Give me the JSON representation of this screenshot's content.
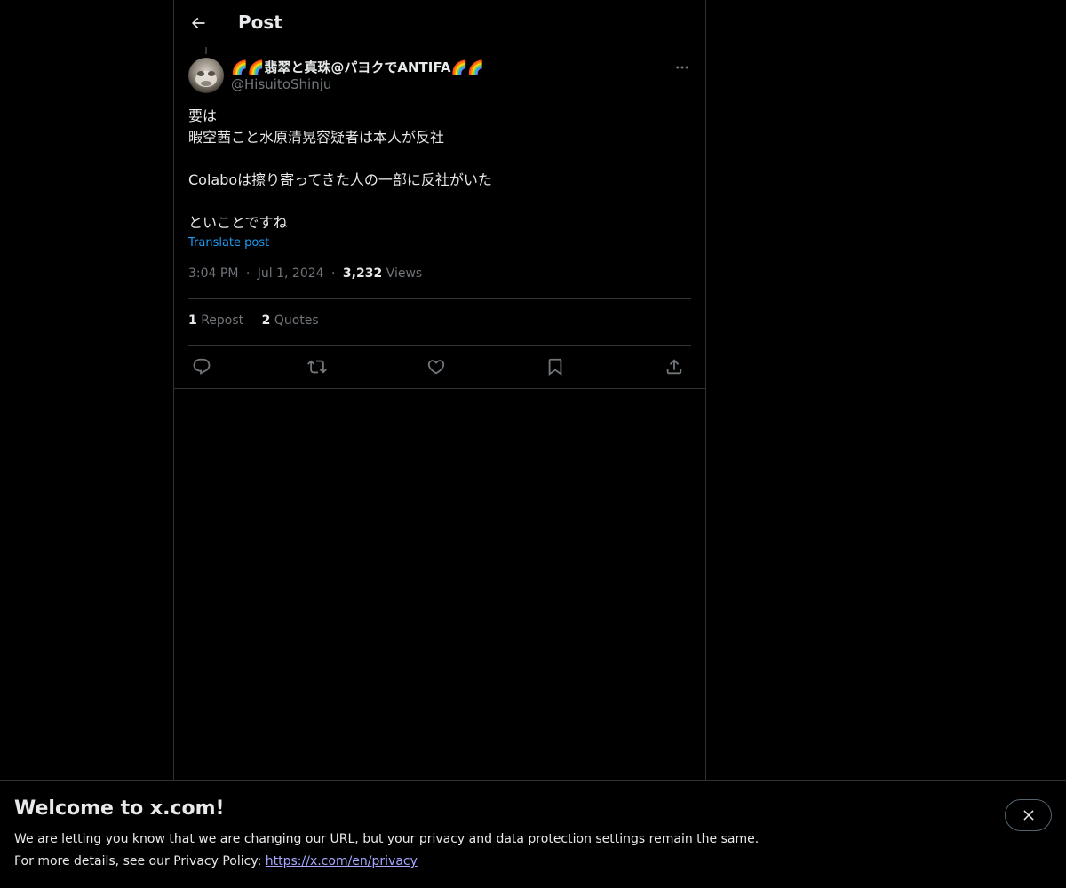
{
  "header": {
    "title": "Post",
    "back_icon": "arrow-left-icon"
  },
  "post": {
    "author": {
      "display_name": "🌈🌈翡翠と真珠@パヨクでANTIFA🌈🌈",
      "handle": "@HisuitoShinju"
    },
    "body_lines": [
      "要は",
      "暇空茜こと水原清晃容疑者は本人が反社",
      "",
      "Colaboは擦り寄ってきた人の一部に反社がいた",
      "",
      "といことですね"
    ],
    "translate_label": "Translate post",
    "time": "3:04 PM",
    "date": "Jul 1, 2024",
    "separator": "·",
    "views_count": "3,232",
    "views_label": "Views",
    "reposts_count": "1",
    "reposts_label": "Repost",
    "quotes_count": "2",
    "quotes_label": "Quotes"
  },
  "actions": {
    "reply_icon": "reply-icon",
    "repost_icon": "repost-icon",
    "like_icon": "heart-icon",
    "bookmark_icon": "bookmark-icon",
    "share_icon": "share-icon"
  },
  "banner": {
    "title": "Welcome to x.com!",
    "line1": "We are letting you know that we are changing our URL, but your privacy and data protection settings remain the same.",
    "line2_prefix": "For more details, see our Privacy Policy: ",
    "link": "https://x.com/en/privacy",
    "close_icon": "close-icon"
  },
  "colors": {
    "background": "#000000",
    "text": "#e7e9ea",
    "secondary_text": "#71767b",
    "accent": "#1d9bf0",
    "link": "#a6a7ff",
    "border": "#2f3336"
  }
}
